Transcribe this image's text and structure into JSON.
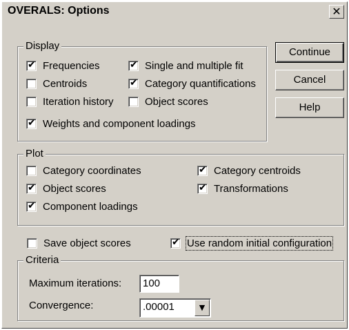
{
  "window": {
    "title": "OVERALS: Options",
    "close_glyph": "✕"
  },
  "display": {
    "legend": "Display",
    "frequencies": {
      "label": "Frequencies",
      "checked": true
    },
    "centroids": {
      "label": "Centroids",
      "checked": false
    },
    "iteration_history": {
      "label": "Iteration history",
      "checked": false
    },
    "weights_loadings": {
      "label": "Weights and component loadings",
      "checked": true
    },
    "single_multiple_fit": {
      "label": "Single and multiple fit",
      "checked": true
    },
    "category_quantifications": {
      "label": "Category quantifications",
      "checked": true
    },
    "object_scores": {
      "label": "Object scores",
      "checked": false
    }
  },
  "plot": {
    "legend": "Plot",
    "category_coordinates": {
      "label": "Category coordinates",
      "checked": false
    },
    "object_scores": {
      "label": "Object scores",
      "checked": true
    },
    "component_loadings": {
      "label": "Component loadings",
      "checked": true
    },
    "category_centroids": {
      "label": "Category centroids",
      "checked": true
    },
    "transformations": {
      "label": "Transformations",
      "checked": true
    }
  },
  "options": {
    "save_object_scores": {
      "label": "Save object scores",
      "checked": false
    },
    "use_random_config": {
      "label": "Use random initial configuration",
      "checked": true
    }
  },
  "criteria": {
    "legend": "Criteria",
    "max_iterations_label": "Maximum iterations:",
    "max_iterations_value": "100",
    "convergence_label": "Convergence:",
    "convergence_value": ".00001"
  },
  "buttons": {
    "continue": "Continue",
    "cancel": "Cancel",
    "help": "Help"
  },
  "icons": {
    "check": "✔",
    "dropdown_arrow": "▼"
  }
}
